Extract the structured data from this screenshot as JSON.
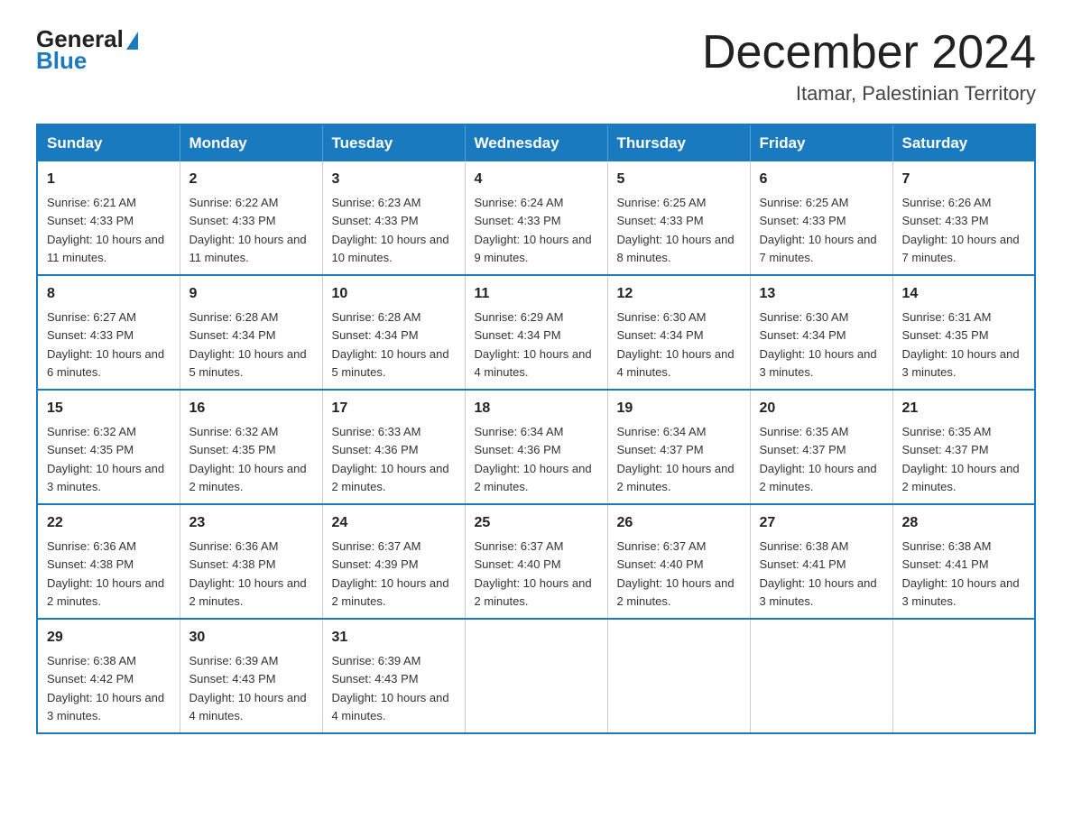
{
  "logo": {
    "text_general": "General",
    "text_blue": "Blue"
  },
  "title": "December 2024",
  "subtitle": "Itamar, Palestinian Territory",
  "headers": [
    "Sunday",
    "Monday",
    "Tuesday",
    "Wednesday",
    "Thursday",
    "Friday",
    "Saturday"
  ],
  "weeks": [
    [
      {
        "day": "1",
        "sunrise": "6:21 AM",
        "sunset": "4:33 PM",
        "daylight": "10 hours and 11 minutes."
      },
      {
        "day": "2",
        "sunrise": "6:22 AM",
        "sunset": "4:33 PM",
        "daylight": "10 hours and 11 minutes."
      },
      {
        "day": "3",
        "sunrise": "6:23 AM",
        "sunset": "4:33 PM",
        "daylight": "10 hours and 10 minutes."
      },
      {
        "day": "4",
        "sunrise": "6:24 AM",
        "sunset": "4:33 PM",
        "daylight": "10 hours and 9 minutes."
      },
      {
        "day": "5",
        "sunrise": "6:25 AM",
        "sunset": "4:33 PM",
        "daylight": "10 hours and 8 minutes."
      },
      {
        "day": "6",
        "sunrise": "6:25 AM",
        "sunset": "4:33 PM",
        "daylight": "10 hours and 7 minutes."
      },
      {
        "day": "7",
        "sunrise": "6:26 AM",
        "sunset": "4:33 PM",
        "daylight": "10 hours and 7 minutes."
      }
    ],
    [
      {
        "day": "8",
        "sunrise": "6:27 AM",
        "sunset": "4:33 PM",
        "daylight": "10 hours and 6 minutes."
      },
      {
        "day": "9",
        "sunrise": "6:28 AM",
        "sunset": "4:34 PM",
        "daylight": "10 hours and 5 minutes."
      },
      {
        "day": "10",
        "sunrise": "6:28 AM",
        "sunset": "4:34 PM",
        "daylight": "10 hours and 5 minutes."
      },
      {
        "day": "11",
        "sunrise": "6:29 AM",
        "sunset": "4:34 PM",
        "daylight": "10 hours and 4 minutes."
      },
      {
        "day": "12",
        "sunrise": "6:30 AM",
        "sunset": "4:34 PM",
        "daylight": "10 hours and 4 minutes."
      },
      {
        "day": "13",
        "sunrise": "6:30 AM",
        "sunset": "4:34 PM",
        "daylight": "10 hours and 3 minutes."
      },
      {
        "day": "14",
        "sunrise": "6:31 AM",
        "sunset": "4:35 PM",
        "daylight": "10 hours and 3 minutes."
      }
    ],
    [
      {
        "day": "15",
        "sunrise": "6:32 AM",
        "sunset": "4:35 PM",
        "daylight": "10 hours and 3 minutes."
      },
      {
        "day": "16",
        "sunrise": "6:32 AM",
        "sunset": "4:35 PM",
        "daylight": "10 hours and 2 minutes."
      },
      {
        "day": "17",
        "sunrise": "6:33 AM",
        "sunset": "4:36 PM",
        "daylight": "10 hours and 2 minutes."
      },
      {
        "day": "18",
        "sunrise": "6:34 AM",
        "sunset": "4:36 PM",
        "daylight": "10 hours and 2 minutes."
      },
      {
        "day": "19",
        "sunrise": "6:34 AM",
        "sunset": "4:37 PM",
        "daylight": "10 hours and 2 minutes."
      },
      {
        "day": "20",
        "sunrise": "6:35 AM",
        "sunset": "4:37 PM",
        "daylight": "10 hours and 2 minutes."
      },
      {
        "day": "21",
        "sunrise": "6:35 AM",
        "sunset": "4:37 PM",
        "daylight": "10 hours and 2 minutes."
      }
    ],
    [
      {
        "day": "22",
        "sunrise": "6:36 AM",
        "sunset": "4:38 PM",
        "daylight": "10 hours and 2 minutes."
      },
      {
        "day": "23",
        "sunrise": "6:36 AM",
        "sunset": "4:38 PM",
        "daylight": "10 hours and 2 minutes."
      },
      {
        "day": "24",
        "sunrise": "6:37 AM",
        "sunset": "4:39 PM",
        "daylight": "10 hours and 2 minutes."
      },
      {
        "day": "25",
        "sunrise": "6:37 AM",
        "sunset": "4:40 PM",
        "daylight": "10 hours and 2 minutes."
      },
      {
        "day": "26",
        "sunrise": "6:37 AM",
        "sunset": "4:40 PM",
        "daylight": "10 hours and 2 minutes."
      },
      {
        "day": "27",
        "sunrise": "6:38 AM",
        "sunset": "4:41 PM",
        "daylight": "10 hours and 3 minutes."
      },
      {
        "day": "28",
        "sunrise": "6:38 AM",
        "sunset": "4:41 PM",
        "daylight": "10 hours and 3 minutes."
      }
    ],
    [
      {
        "day": "29",
        "sunrise": "6:38 AM",
        "sunset": "4:42 PM",
        "daylight": "10 hours and 3 minutes."
      },
      {
        "day": "30",
        "sunrise": "6:39 AM",
        "sunset": "4:43 PM",
        "daylight": "10 hours and 4 minutes."
      },
      {
        "day": "31",
        "sunrise": "6:39 AM",
        "sunset": "4:43 PM",
        "daylight": "10 hours and 4 minutes."
      },
      null,
      null,
      null,
      null
    ]
  ]
}
